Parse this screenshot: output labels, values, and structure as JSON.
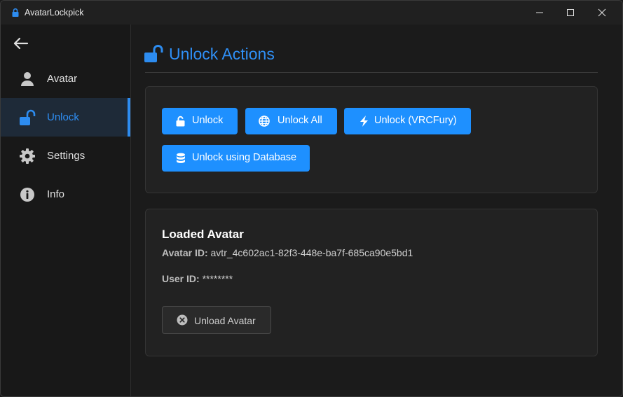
{
  "window": {
    "title": "AvatarLockpick",
    "controls": {
      "minimize": "minimize-icon",
      "maximize": "maximize-icon",
      "close": "close-icon"
    }
  },
  "sidebar": {
    "back_icon": "arrow-left-icon",
    "items": [
      {
        "label": "Avatar",
        "icon": "user-icon",
        "active": false
      },
      {
        "label": "Unlock",
        "icon": "unlock-icon",
        "active": true
      },
      {
        "label": "Settings",
        "icon": "gear-icon",
        "active": false
      },
      {
        "label": "Info",
        "icon": "info-icon",
        "active": false
      }
    ]
  },
  "main": {
    "title": "Unlock Actions",
    "title_icon": "unlock-icon",
    "actions": [
      {
        "label": "Unlock",
        "icon": "unlock-icon"
      },
      {
        "label": "Unlock All",
        "icon": "globe-icon"
      },
      {
        "label": "Unlock (VRCFury)",
        "icon": "bolt-icon"
      },
      {
        "label": "Unlock using Database",
        "icon": "database-icon"
      }
    ],
    "loaded": {
      "heading": "Loaded Avatar",
      "avatar_id_label": "Avatar ID:",
      "avatar_id_value": "avtr_4c602ac1-82f3-448e-ba7f-685ca90e5bd1",
      "user_id_label": "User ID:",
      "user_id_value": "********",
      "unload_label": "Unload Avatar",
      "unload_icon": "close-circle-icon"
    }
  },
  "colors": {
    "accent": "#1e90ff",
    "accent_text": "#2f8ff5",
    "background": "#1b1b1b",
    "sidebar": "#181818",
    "card": "#222222"
  }
}
